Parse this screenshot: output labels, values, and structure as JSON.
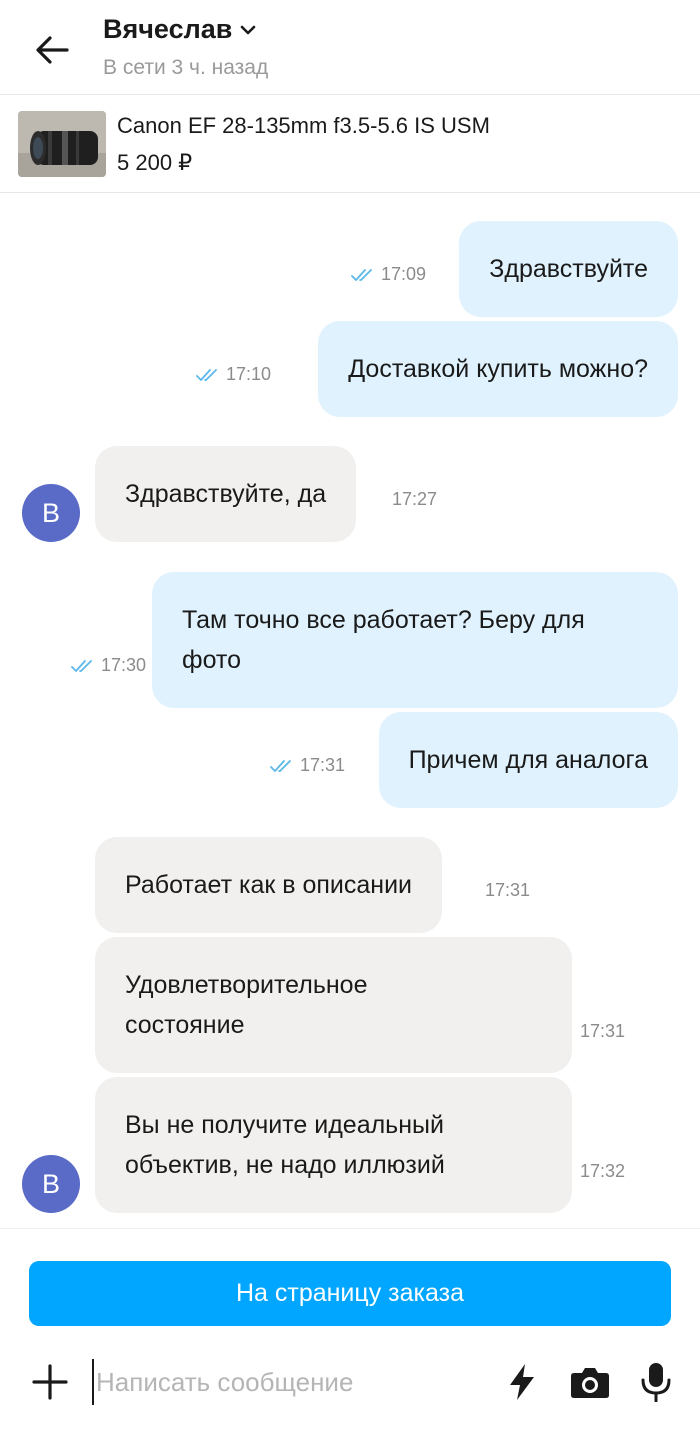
{
  "header": {
    "name": "Вячеслав",
    "status": "В сети 3 ч. назад"
  },
  "product": {
    "title": "Canon EF 28-135mm f3.5-5.6 IS USM",
    "price": "5 200 ₽"
  },
  "messages": [
    {
      "direction": "out",
      "text": "Здравствуйте",
      "time": "17:09",
      "read": true
    },
    {
      "direction": "out",
      "text": "Доставкой купить можно?",
      "time": "17:10",
      "read": true
    },
    {
      "direction": "in",
      "text": "Здравствуйте, да",
      "time": "17:27",
      "avatar": "В"
    },
    {
      "direction": "out",
      "text_lines": [
        "Там точно все работает? Беру для",
        "фото"
      ],
      "time": "17:30",
      "read": true
    },
    {
      "direction": "out",
      "text": "Причем для аналога",
      "time": "17:31",
      "read": true
    },
    {
      "direction": "in",
      "text": "Работает как в описании",
      "time": "17:31"
    },
    {
      "direction": "in",
      "text_lines": [
        "Удовлетворительное",
        "состояние"
      ],
      "time": "17:31"
    },
    {
      "direction": "in",
      "text_lines": [
        "Вы не получите идеальный",
        "объектив, не надо иллюзий"
      ],
      "time": "17:32",
      "avatar": "В"
    }
  ],
  "footer": {
    "order_button": "На страницу заказа",
    "input_placeholder": "Написать сообщение",
    "input_value": ""
  },
  "icons": [
    "back-arrow-icon",
    "chevron-down-icon",
    "double-check-icon",
    "plus-icon",
    "lightning-icon",
    "camera-icon",
    "microphone-icon"
  ],
  "colors": {
    "outgoing_bubble": "#dff2fd",
    "incoming_bubble": "#f1f0ee",
    "avatar": "#5a6bc7",
    "primary_button": "#00a6ff",
    "read_check": "#5bb8e8"
  }
}
